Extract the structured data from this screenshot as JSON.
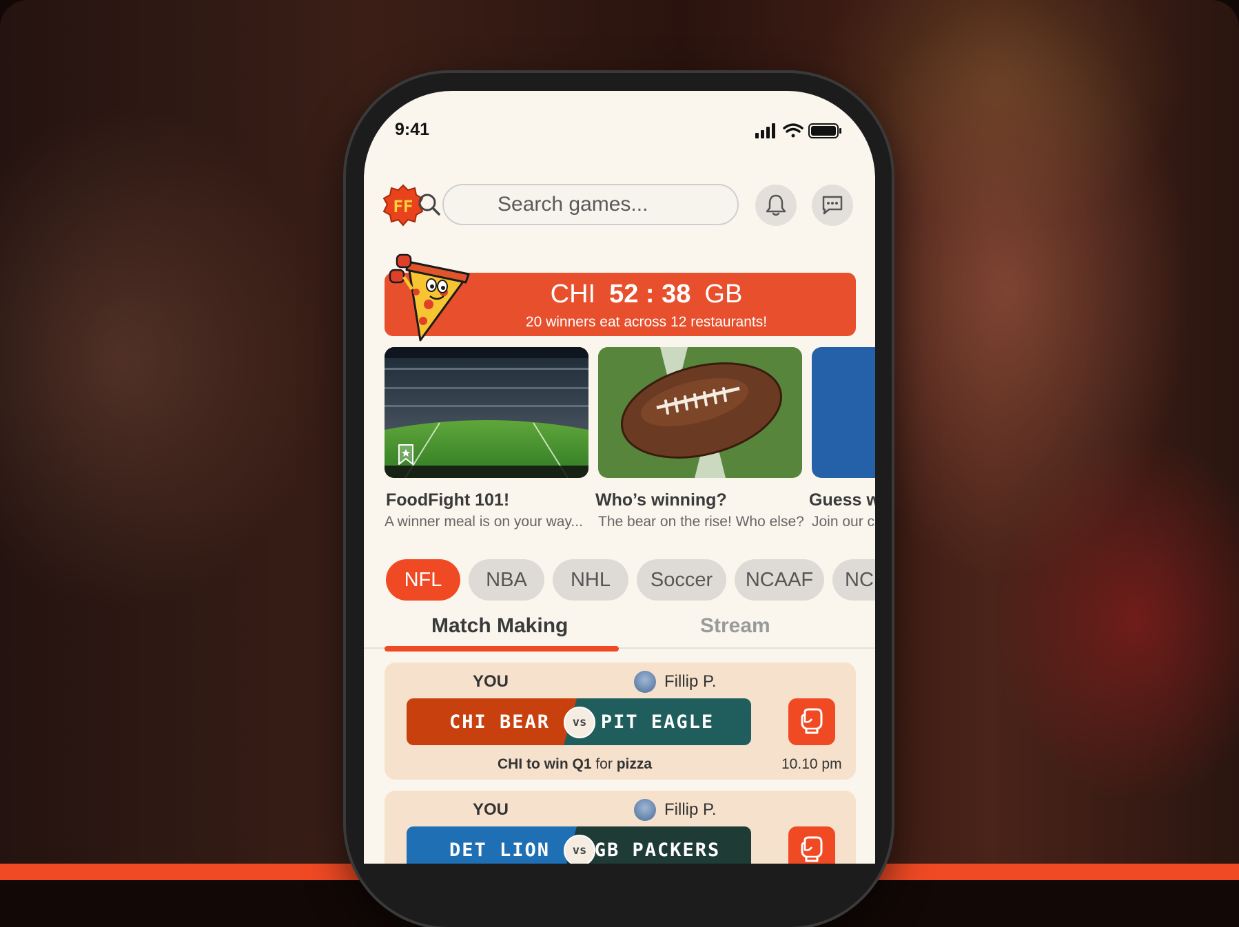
{
  "status_bar": {
    "time": "9:41"
  },
  "header": {
    "search_placeholder": "Search games...",
    "logo_text": "FF"
  },
  "score_banner": {
    "team_home": "CHI",
    "score": "52 : 38",
    "team_away": "GB",
    "subtitle": "20 winners eat across 12 restaurants!"
  },
  "cards": [
    {
      "title": "FoodFight 101!",
      "desc": "A winner meal is on your way..."
    },
    {
      "title": "Who’s winning?",
      "desc": "The bear on the rise! Who else?"
    },
    {
      "title": "Guess w",
      "desc": "Join our c"
    }
  ],
  "sports": [
    "NFL",
    "NBA",
    "NHL",
    "Soccer",
    "NCAAF",
    "NC"
  ],
  "tabs": [
    "Match Making",
    "Stream"
  ],
  "matches": [
    {
      "you_label": "YOU",
      "opponent": "Fillip P.",
      "team_left": "CHI BEAR",
      "team_right": "PIT EAGLE",
      "vs": "vs",
      "bet_subject": "CHI to win Q1",
      "bet_for": "for",
      "bet_prize": "pizza",
      "time": "10.10 pm",
      "left_color": "#c9400f",
      "right_color": "#1f5e5c"
    },
    {
      "you_label": "YOU",
      "opponent": "Fillip P.",
      "team_left": "DET LION",
      "team_right": "GB PACKERS",
      "vs": "vs",
      "left_color": "#1f6fb5",
      "right_color": "#1e3b35"
    }
  ],
  "colors": {
    "accent": "#f04a24",
    "screen_bg": "#faf6ee",
    "card_bg": "#f5e1cc"
  }
}
